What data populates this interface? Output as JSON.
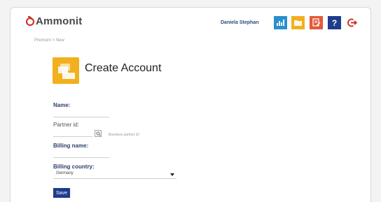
{
  "header": {
    "logo_text": "Ammonit",
    "user_name": "Daniela Stephan",
    "toolbar": {
      "chart_icon": "chart-icon",
      "folder_icon": "folder-icon",
      "doc_icon": "document-edit-icon",
      "help_label": "?",
      "logout_icon": "logout-icon"
    }
  },
  "breadcrumb": "Premium > New",
  "page": {
    "title": "Create Account",
    "icon": "create-account-icon"
  },
  "form": {
    "name": {
      "label": "Name:",
      "value": ""
    },
    "partner_id": {
      "label": "Partner id:",
      "value": "",
      "hint": "Business partner ID"
    },
    "billing_name": {
      "label": "Billing name:",
      "value": ""
    },
    "billing_country": {
      "label": "Billing country:",
      "value": "Germany"
    },
    "save_label": "Save"
  },
  "colors": {
    "brand_red": "#cc2a1e",
    "accent_blue": "#2a8fcc",
    "accent_yellow": "#f2b01e",
    "accent_orange": "#e3593a",
    "dark_blue": "#1f3b8c"
  }
}
